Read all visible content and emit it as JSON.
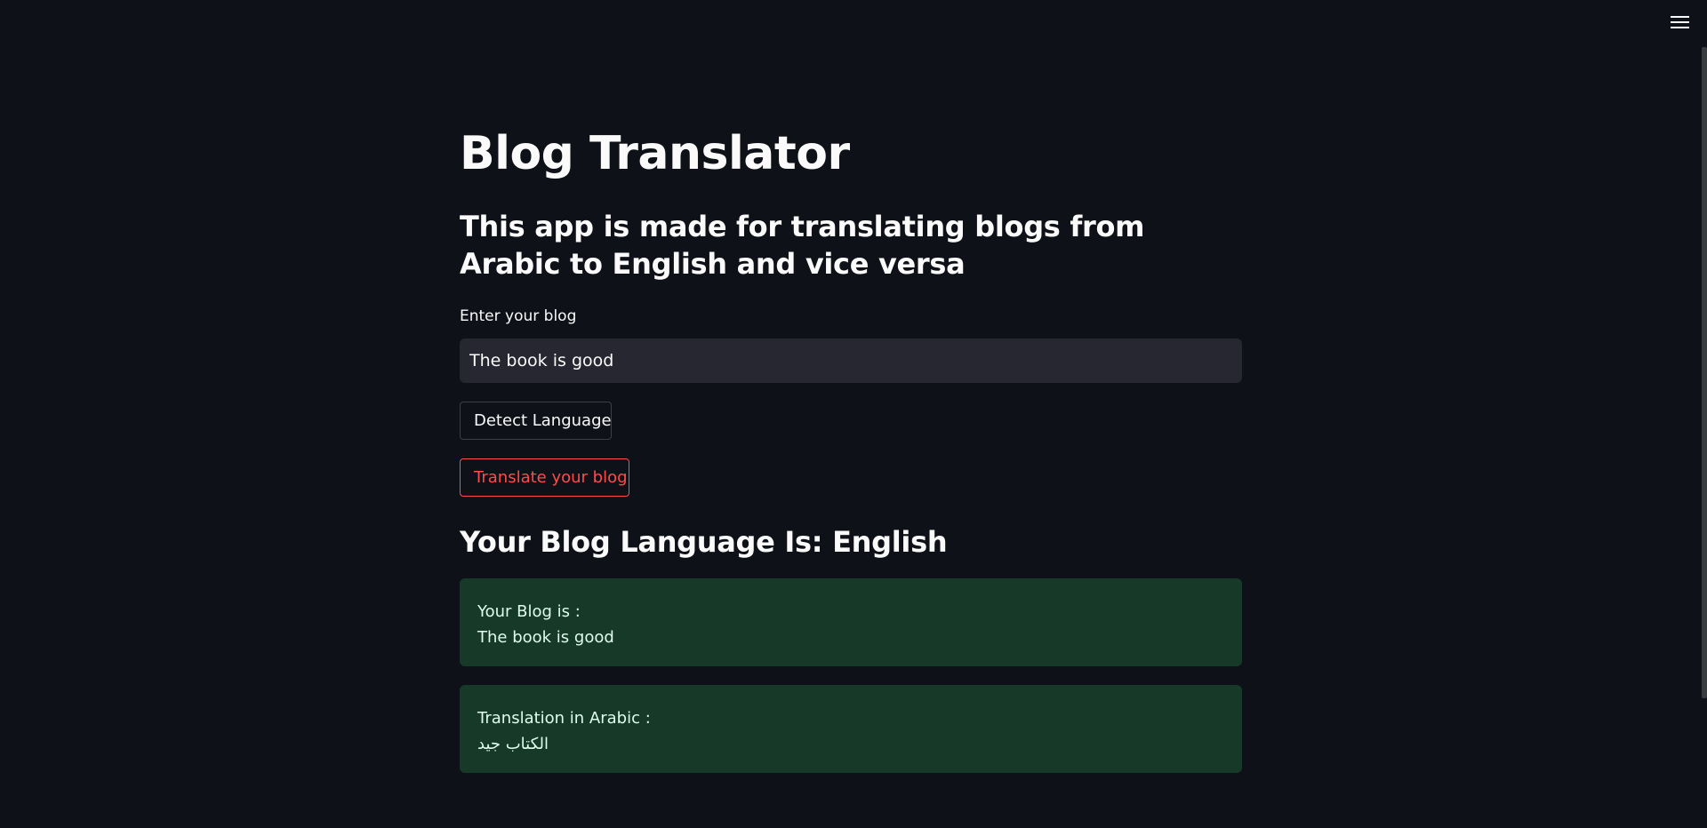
{
  "header": {
    "menu_icon": "hamburger-menu-icon"
  },
  "main": {
    "title": "Blog Translator",
    "subtitle": "This app is made for translating blogs from Arabic to English and vice versa",
    "input_label": "Enter your blog",
    "input_value": "The book is good",
    "detect_button_label": "Detect Language",
    "translate_button_label": "Translate your blog",
    "result_heading": "Your Blog Language Is: English",
    "blog_alert": {
      "label": "Your Blog is :",
      "value": "The book is good"
    },
    "translation_alert": {
      "label": "Translation in Arabic :",
      "value": "الكتاب جيد"
    }
  },
  "colors": {
    "background": "#0e1117",
    "input_background": "#262730",
    "accent": "#ff4b4b",
    "success_background": "#173928",
    "success_text": "#dffde9"
  }
}
